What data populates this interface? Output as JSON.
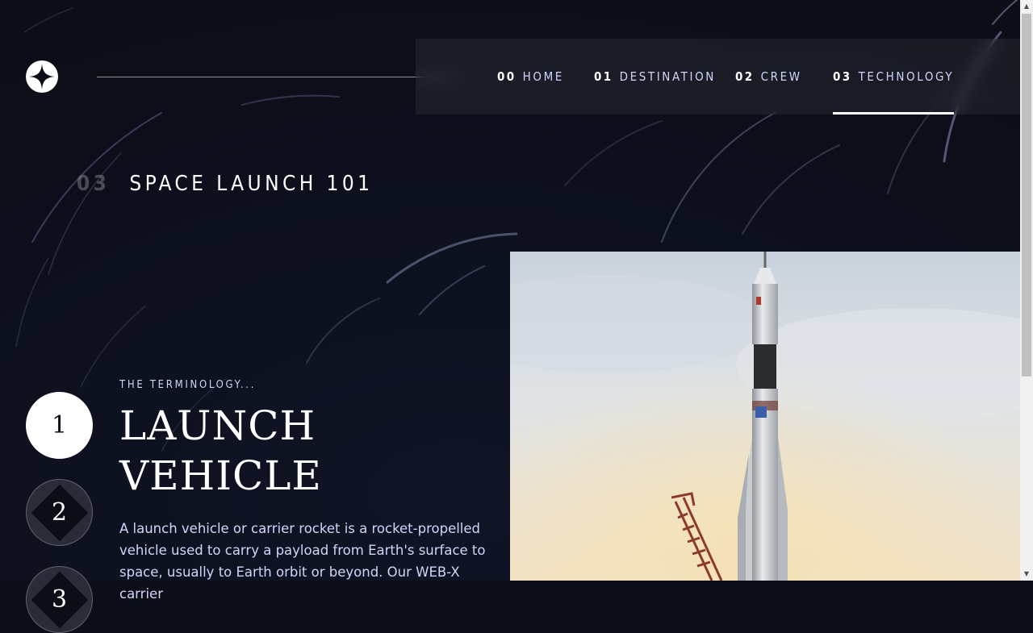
{
  "nav": {
    "items": [
      {
        "num": "00",
        "label": "HOME"
      },
      {
        "num": "01",
        "label": "DESTINATION"
      },
      {
        "num": "02",
        "label": "CREW"
      },
      {
        "num": "03",
        "label": "TECHNOLOGY"
      }
    ],
    "active": "TECHNOLOGY"
  },
  "page": {
    "number": "03",
    "heading": "SPACE LAUNCH 101"
  },
  "steps": [
    "1",
    "2",
    "3"
  ],
  "active_step": "1",
  "content": {
    "eyebrow": "THE TERMINOLOGY...",
    "title": "LAUNCH VEHICLE",
    "description": "A launch vehicle or carrier rocket is a rocket-propelled vehicle used to carry a payload from Earth's surface to space, usually to Earth orbit or beyond. Our WEB-X carrier"
  },
  "colors": {
    "background": "#0b0d17",
    "accent_text": "#d0d6f9",
    "white": "#ffffff"
  },
  "icons": {
    "logo": "star-logo-icon",
    "scroll_up": "arrow-up-icon",
    "scroll_down": "arrow-down-icon"
  }
}
